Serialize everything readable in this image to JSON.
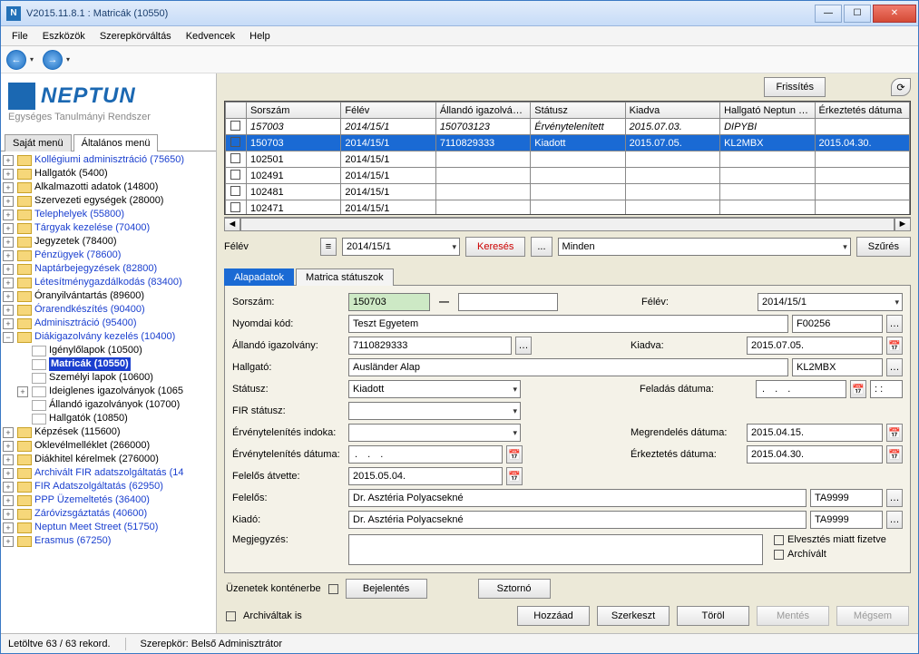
{
  "window": {
    "title": "V2015.11.8.1 : Matricák (10550)"
  },
  "menu": {
    "file": "File",
    "tools": "Eszközök",
    "role": "Szerepkörváltás",
    "fav": "Kedvencek",
    "help": "Help"
  },
  "logo": {
    "text": "NEPTUN",
    "sub": "Egységes Tanulmányi Rendszer"
  },
  "left_tabs": {
    "own": "Saját menü",
    "general": "Általános menü"
  },
  "tree": {
    "n0": "Kollégiumi adminisztráció (75650)",
    "n1": "Hallgatók (5400)",
    "n2": "Alkalmazotti adatok (14800)",
    "n3": "Szervezeti egységek (28000)",
    "n4": "Telephelyek (55800)",
    "n5": "Tárgyak kezelése (70400)",
    "n6": "Jegyzetek (78400)",
    "n7": "Pénzügyek (78600)",
    "n8": "Naptárbejegyzések (82800)",
    "n9": "Létesítménygazdálkodás (83400)",
    "n10": "Óranyilvántartás (89600)",
    "n11": "Órarendkészítés (90400)",
    "n12": "Adminisztráció (95400)",
    "n13": "Diákigazolvány kezelés (10400)",
    "n13a": "Igénylőlapok (10500)",
    "n13b": "Matricák (10550)",
    "n13c": "Személyi lapok (10600)",
    "n13d": "Ideiglenes igazolványok (1065",
    "n13e": "Állandó igazolványok (10700)",
    "n13f": "Hallgatók (10850)",
    "n14": "Képzések (115600)",
    "n15": "Oklevélmelléklet (266000)",
    "n16": "Diákhitel kérelmek (276000)",
    "n17": "Archivált FIR adatszolgáltatás (14",
    "n18": "FIR Adatszolgáltatás (62950)",
    "n19": "PPP Üzemeltetés (36400)",
    "n20": "Záróvizsgáztatás (40600)",
    "n21": "Neptun Meet Street (51750)",
    "n22": "Erasmus (67250)"
  },
  "refresh": "Frissítés",
  "grid": {
    "h_sor": "Sorszám",
    "h_felev": "Félév",
    "h_allando": "Állandó igazolván…",
    "h_status": "Státusz",
    "h_kiadva": "Kiadva",
    "h_neptun": "Hallgató Neptun …",
    "h_erk": "Érkeztetés dátuma",
    "rows": [
      {
        "sor": "157003",
        "felev": "2014/15/1",
        "allando": "150703123",
        "status": "Érvénytelenített",
        "kiadva": "2015.07.03.",
        "neptun": "DIPYBI",
        "erk": ""
      },
      {
        "sor": "150703",
        "felev": "2014/15/1",
        "allando": "7110829333",
        "status": "Kiadott",
        "kiadva": "2015.07.05.",
        "neptun": "KL2MBX",
        "erk": "2015.04.30."
      },
      {
        "sor": "102501",
        "felev": "2014/15/1",
        "allando": "",
        "status": "",
        "kiadva": "",
        "neptun": "",
        "erk": ""
      },
      {
        "sor": "102491",
        "felev": "2014/15/1",
        "allando": "",
        "status": "",
        "kiadva": "",
        "neptun": "",
        "erk": ""
      },
      {
        "sor": "102481",
        "felev": "2014/15/1",
        "allando": "",
        "status": "",
        "kiadva": "",
        "neptun": "",
        "erk": ""
      },
      {
        "sor": "102471",
        "felev": "2014/15/1",
        "allando": "",
        "status": "",
        "kiadva": "",
        "neptun": "",
        "erk": ""
      }
    ]
  },
  "filter": {
    "felev_lab": "Félév",
    "felev_val": "2014/15/1",
    "kereses": "Keresés",
    "minden": "Minden",
    "szures": "Szűrés",
    "ellipsis": "..."
  },
  "subtabs": {
    "alap": "Alapadatok",
    "mstat": "Matrica státuszok"
  },
  "form": {
    "sorszam_lab": "Sorszám:",
    "sorszam_val": "150703",
    "felev_lab": "Félév:",
    "felev_val": "2014/15/1",
    "nyomdai_lab": "Nyomdai kód:",
    "nyomdai_val": "Teszt Egyetem",
    "nyomdai_code": "F00256",
    "allando_lab": "Állandó igazolvány:",
    "allando_val": "7110829333",
    "kiadva_lab": "Kiadva:",
    "kiadva_val": "2015.07.05.",
    "hallgato_lab": "Hallgató:",
    "hallgato_val": "Ausländer Alap",
    "hallgato_code": "KL2MBX",
    "status_lab": "Státusz:",
    "status_val": "Kiadott",
    "feladas_lab": "Feladás dátuma:",
    "feladas_val": ". . .",
    "feladas_time": ": :",
    "fir_lab": "FIR státusz:",
    "ervind_lab": "Érvénytelenítés indoka:",
    "megrend_lab": "Megrendelés dátuma:",
    "megrend_val": "2015.04.15.",
    "ervdat_lab": "Érvénytelenítés dátuma:",
    "ervdat_val": ". . .",
    "erk_lab": "Érkeztetés dátuma:",
    "erk_val": "2015.04.30.",
    "atvette_lab": "Felelős átvette:",
    "atvette_val": "2015.05.04.",
    "felelos_lab": "Felelős:",
    "felelos_val": "Dr. Asztéria Polyacsekné",
    "felelos_code": "TA9999",
    "kiado_lab": "Kiadó:",
    "kiado_val": "Dr. Asztéria Polyacsekné",
    "kiado_code": "TA9999",
    "megj_lab": "Megjegyzés:",
    "elveszt_lab": "Elvesztés miatt fizetve",
    "archiv_lab": "Archívált"
  },
  "bottom": {
    "uzenetek": "Üzenetek konténerbe",
    "bejelentes": "Bejelentés",
    "storno": "Sztornó",
    "archivaltak": "Archiváltak is",
    "hozzaad": "Hozzáad",
    "szerkeszt": "Szerkeszt",
    "torol": "Töröl",
    "mentes": "Mentés",
    "megsem": "Mégsem"
  },
  "status": {
    "loaded": "Letöltve 63 / 63 rekord.",
    "role": "Szerepkör: Belső Adminisztrátor"
  }
}
